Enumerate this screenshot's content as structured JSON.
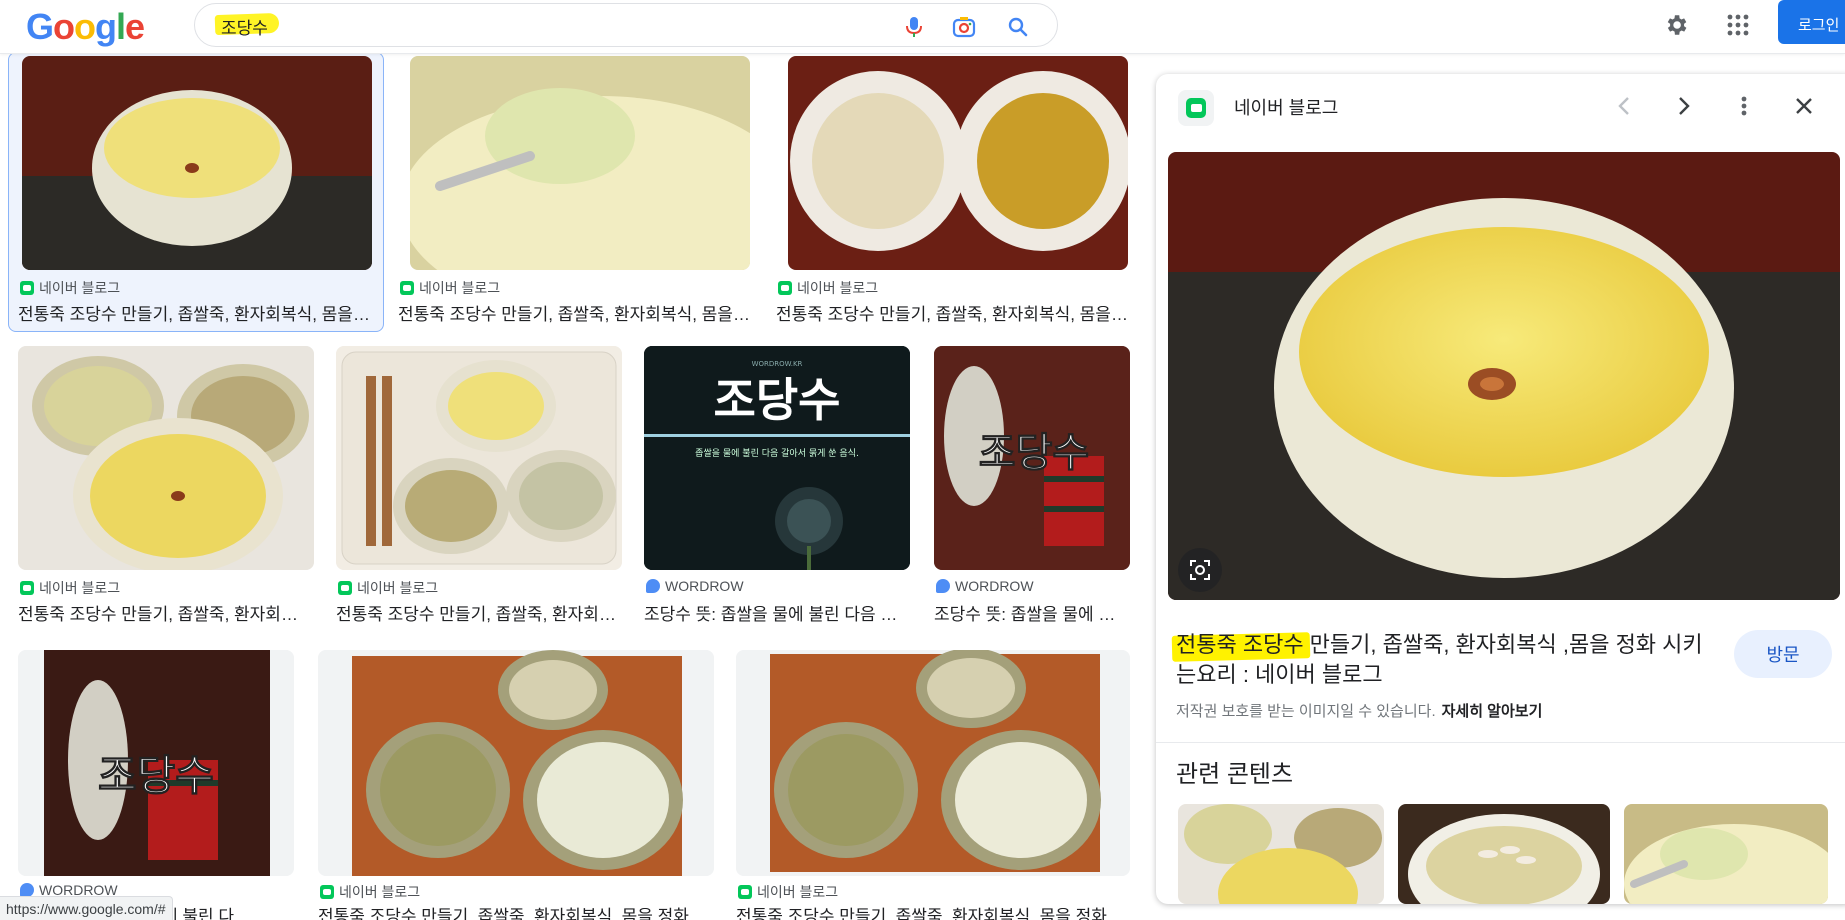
{
  "header": {
    "logo": [
      "G",
      "o",
      "o",
      "g",
      "l",
      "e"
    ],
    "query": "조당수",
    "login_label": "로그인"
  },
  "icons": {
    "mic": "microphone-icon",
    "lens": "camera-lens-icon",
    "search": "search-icon",
    "settings": "gear-icon",
    "apps": "apps-grid-icon"
  },
  "results": [
    {
      "source": "네이버 블로그",
      "source_type": "naver",
      "title": "전통죽 조당수 만들기, 좁쌀죽, 환자회복식, 몸을 정화 시키는요리 : 네이버 블로그"
    },
    {
      "source": "네이버 블로그",
      "source_type": "naver",
      "title": "전통죽 조당수 만들기, 좁쌀죽, 환자회복식, 몸을 정화 시키는요리"
    },
    {
      "source": "네이버 블로그",
      "source_type": "naver",
      "title": "전통죽 조당수 만들기, 좁쌀죽, 환자회복식, 몸을 정화 시키는요리"
    },
    {
      "source": "네이버 블로그",
      "source_type": "naver",
      "title": "전통죽 조당수 만들기, 좁쌀죽, 환자회복식"
    },
    {
      "source": "네이버 블로그",
      "source_type": "naver",
      "title": "전통죽 조당수 만들기, 좁쌀죽, 환자회복식"
    },
    {
      "source": "WORDROW",
      "source_type": "wordrow",
      "title": "조당수 뜻: 좁쌀을 물에 불린 다음 갈아서"
    },
    {
      "source": "WORDROW",
      "source_type": "wordrow",
      "title": "조당수 뜻: 좁쌀을 물에 불린 다음"
    },
    {
      "source": "WORDROW",
      "source_type": "wordrow",
      "title": "조당수 뜻: 좁쌀을 물에 불린 다"
    },
    {
      "source": "네이버 블로그",
      "source_type": "naver",
      "title": "전통죽 조당수 만들기, 좁쌀죽, 환자회복식, 몸을 정화"
    },
    {
      "source": "네이버 블로그",
      "source_type": "naver",
      "title": "전통죽 조당수 만들기, 좁쌀죽, 환자회복식, 몸을 정화"
    }
  ],
  "overlay_text": {
    "big": "조당수",
    "caption": "좁쌀을 물에 불린 다음 갈아서 묽게 쑨 음식.",
    "site": "WORDROW.KR"
  },
  "statusbar": "https://www.google.com/#",
  "panel": {
    "source": "네이버 블로그",
    "title": "전통죽 조당수 만들기, 좁쌀죽, 환자회복식 ,몸을 정화 시키는요리 : 네이버 블로그",
    "visit": "방문",
    "copyright": "저작권 보호를 받는 이미지일 수 있습니다.",
    "learn_more": "자세히 알아보기",
    "related": "관련 콘텐츠"
  },
  "colors": {
    "accent": "#1a73e8",
    "highlight": "#fff200",
    "naver_green": "#03c75a",
    "porridge": "#f2d64b"
  }
}
